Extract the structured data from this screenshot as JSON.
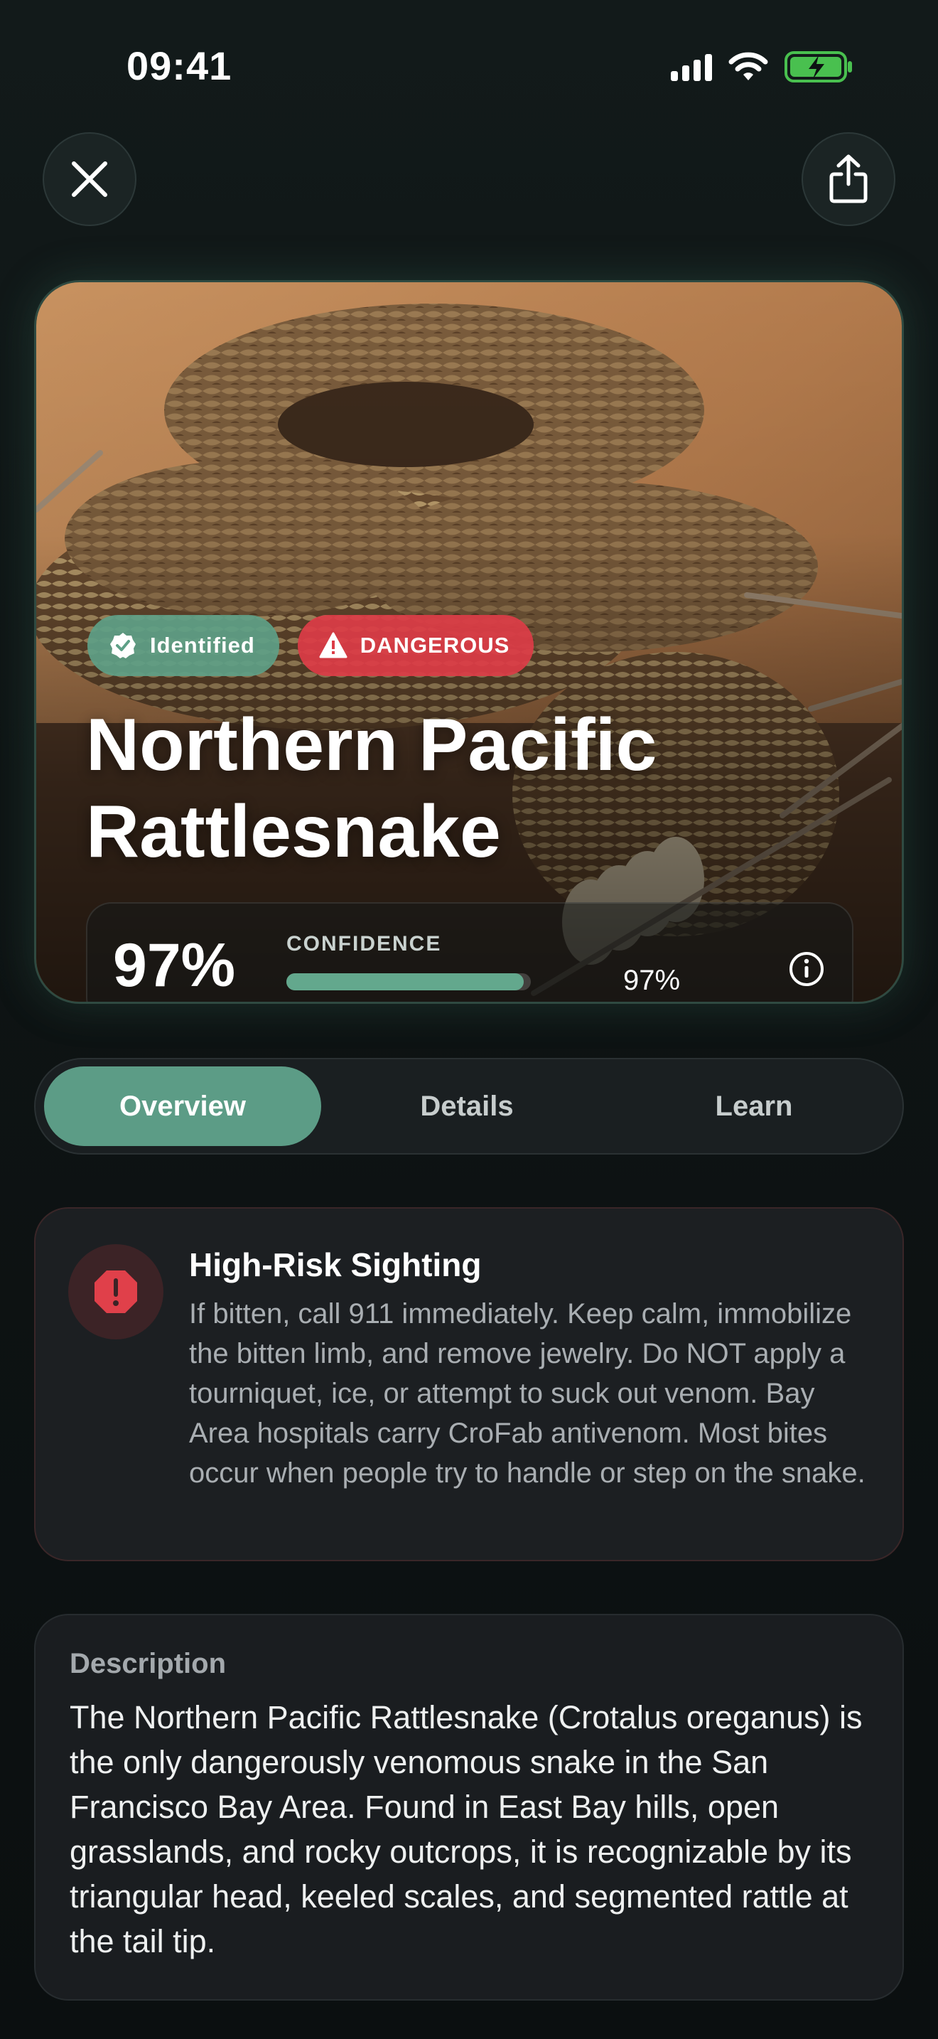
{
  "status_bar": {
    "time": "09:41"
  },
  "header": {
    "close_icon": "close-icon",
    "share_icon": "share-icon"
  },
  "hero": {
    "badges": {
      "identified": "Identified",
      "danger": "DANGEROUS"
    },
    "title_line1": "Northern Pacific",
    "title_line2": "Rattlesnake",
    "confidence": {
      "value_text": "97%",
      "label": "CONFIDENCE",
      "bar_text": "97%",
      "level": 0.97
    }
  },
  "tabs": [
    {
      "label": "Overview",
      "active": true
    },
    {
      "label": "Details",
      "active": false
    },
    {
      "label": "Learn",
      "active": false
    }
  ],
  "alert": {
    "title": "High-Risk Sighting",
    "body": "If bitten, call 911 immediately. Keep calm, immobilize the bitten limb, and remove jewelry. Do NOT apply a tourniquet, ice, or attempt to suck out venom. Bay Area hospitals carry CroFab antivenom. Most bites occur when people try to handle or step on the snake.",
    "accent_color": "#e0404a"
  },
  "description": {
    "label": "Description",
    "body": "The Northern Pacific Rattlesnake (Crotalus oreganus) is the only dangerously venomous snake in the San Francisco Bay Area. Found in East Bay hills, open grasslands, and rocky outcrops, it is recognizable by its triangular head, keeled scales, and segmented rattle at the tail tip."
  },
  "colors": {
    "accent_green": "#5c9c86",
    "danger_red": "#dc3c46",
    "background": "#0d1212"
  }
}
